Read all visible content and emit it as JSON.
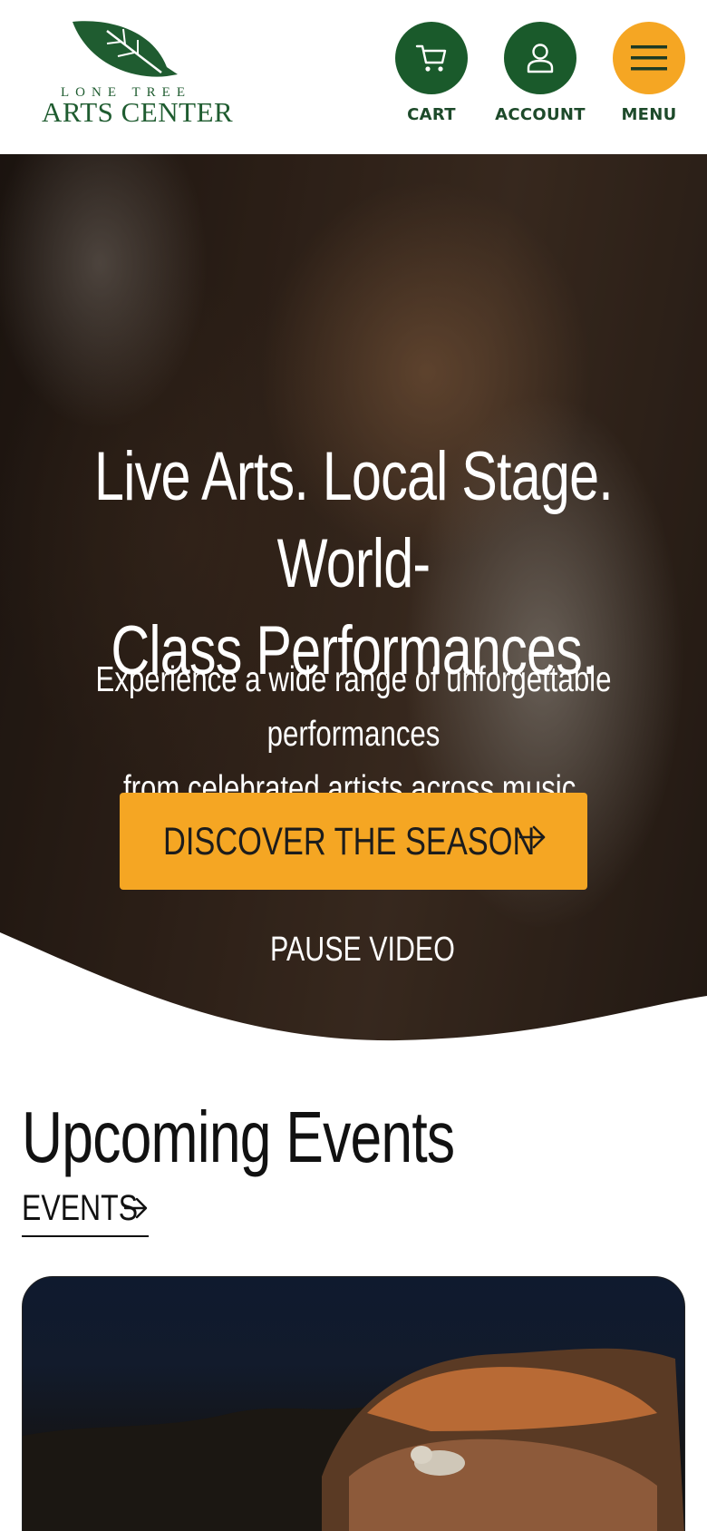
{
  "header": {
    "logo_small": "LONE TREE",
    "logo_big": "ARTS CENTER",
    "nav": [
      {
        "label": "CART",
        "icon": "cart-icon"
      },
      {
        "label": "ACCOUNT",
        "icon": "user-icon"
      },
      {
        "label": "MENU",
        "icon": "hamburger-icon"
      }
    ]
  },
  "hero": {
    "title": "Live Arts. Local Stage. World-Class Performances.",
    "title_line1": "Live Arts. Local Stage. World-",
    "title_line2": "Class Performances.",
    "subtitle_line1": "Experience a wide range of unforgettable performances",
    "subtitle_line2": "from celebrated artists across music, theater, and dance.",
    "cta_label": "DISCOVER THE SEASON",
    "cta_icon": "arrow-right-icon",
    "pause_label": "PAUSE VIDEO",
    "pause_icon": "pause-circle-icon"
  },
  "upcoming": {
    "title": "Upcoming Events",
    "link_label": "EVENTS",
    "link_icon": "arrow-right-icon"
  },
  "colors": {
    "brand_green": "#1a5a2b",
    "accent_orange": "#f5a623",
    "text_dark": "#111111"
  }
}
